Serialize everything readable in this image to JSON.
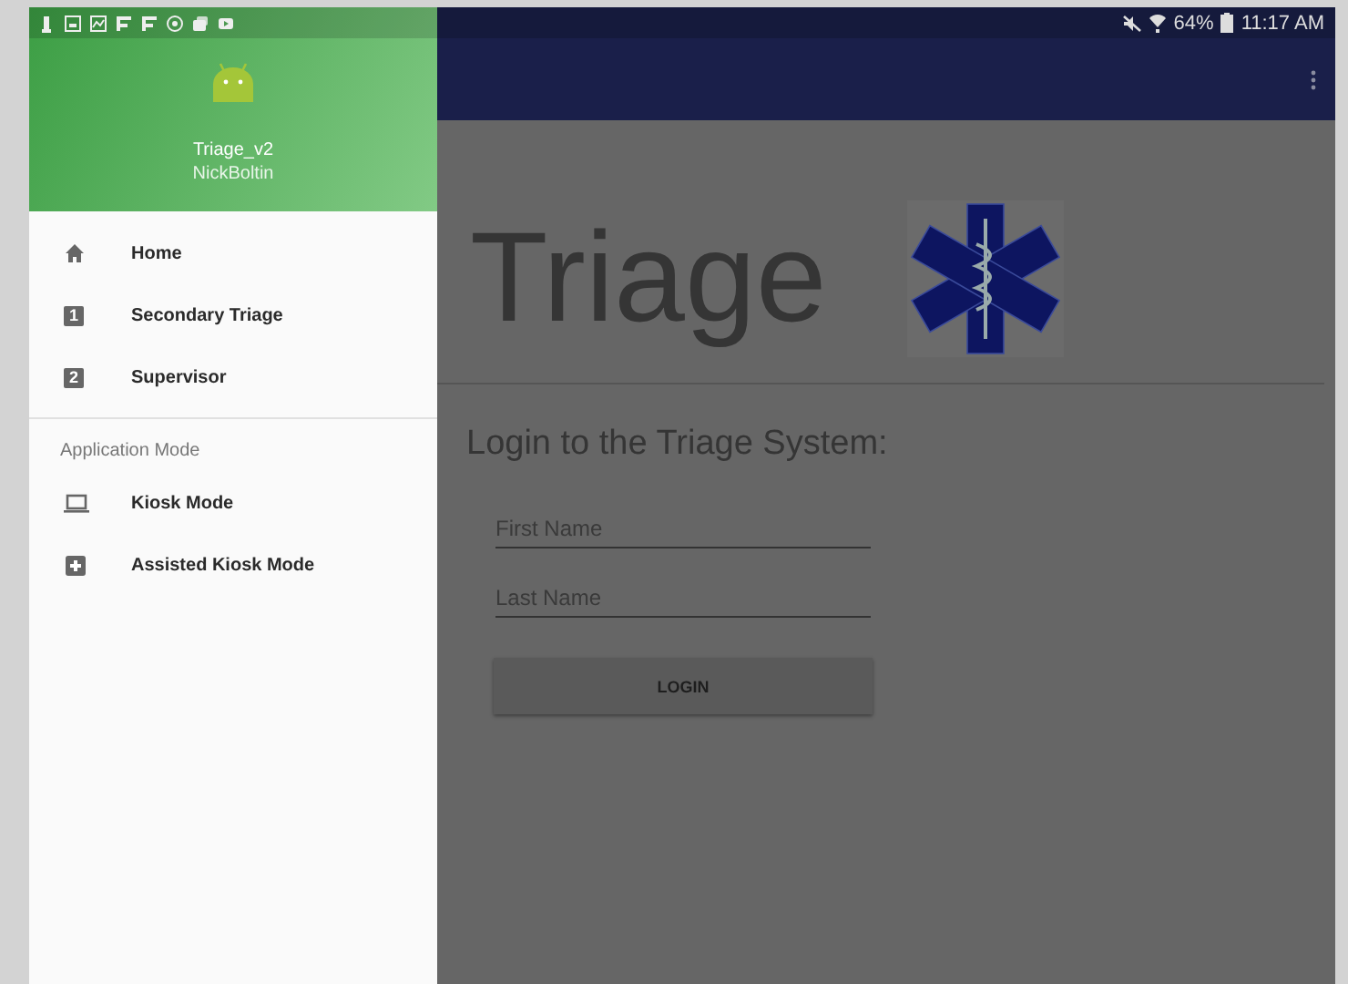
{
  "status_bar": {
    "battery": "64%",
    "time": "11:17 AM"
  },
  "drawer": {
    "header": {
      "app_name": "Triage_v2",
      "user": "NickBoltin"
    },
    "items": [
      {
        "kind": "icon",
        "label": "Home"
      },
      {
        "kind": "number",
        "glyph": "1",
        "label": "Secondary Triage"
      },
      {
        "kind": "number",
        "glyph": "2",
        "label": "Supervisor"
      }
    ],
    "section": {
      "title": "Application Mode",
      "items": [
        {
          "kind": "icon",
          "label": "Kiosk Mode"
        },
        {
          "kind": "icon",
          "label": "Assisted Kiosk Mode"
        }
      ]
    }
  },
  "content": {
    "title": "Triage",
    "subtitle": "Login to the Triage System:",
    "fields": [
      {
        "placeholder": "First Name"
      },
      {
        "placeholder": "Last Name"
      }
    ],
    "button": "LOGIN"
  }
}
